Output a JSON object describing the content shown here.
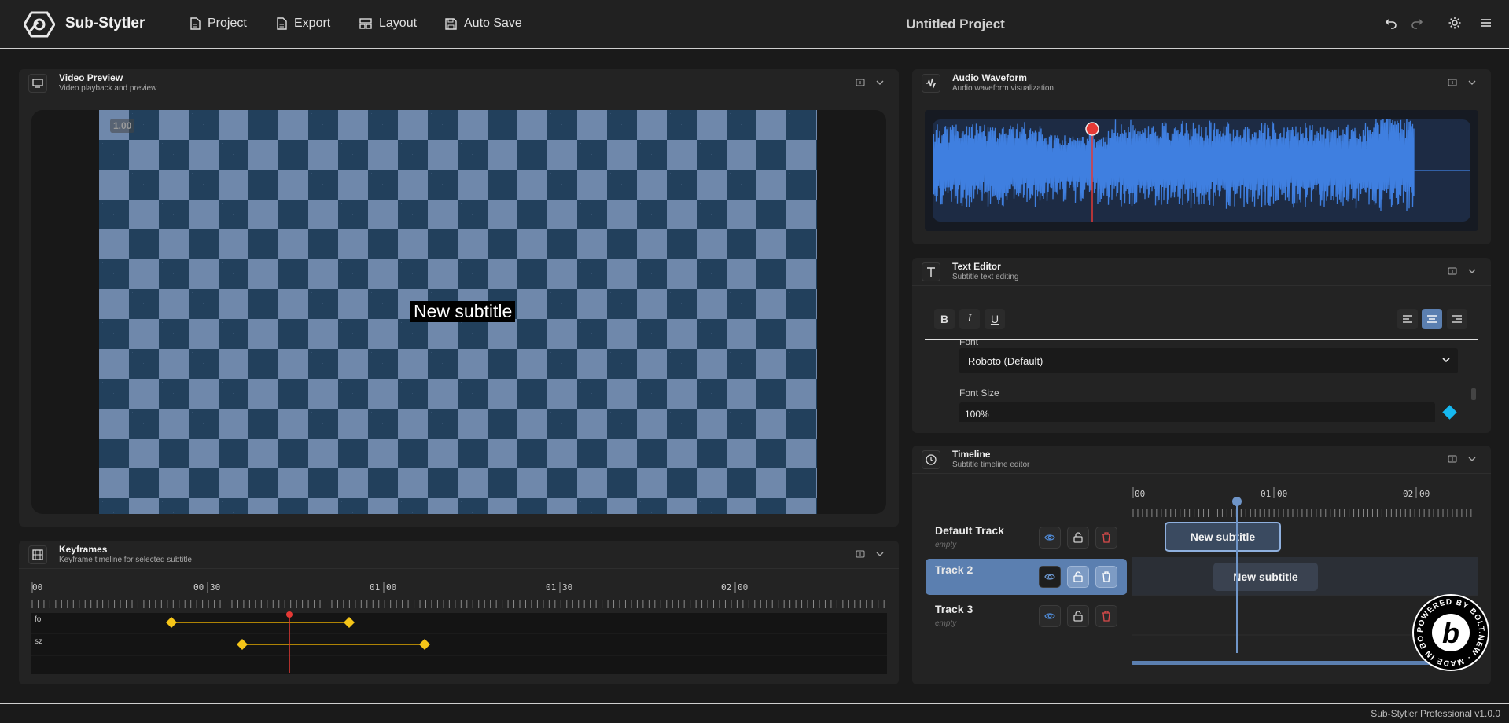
{
  "header": {
    "app_name": "Sub-Stytler",
    "menu": [
      {
        "label": "Project",
        "icon": "file-icon"
      },
      {
        "label": "Export",
        "icon": "file-export-icon"
      },
      {
        "label": "Layout",
        "icon": "layout-icon"
      },
      {
        "label": "Auto Save",
        "icon": "save-icon"
      }
    ],
    "project_title": "Untitled Project",
    "icons": [
      "undo-icon",
      "redo-icon",
      "sun-icon",
      "hamburger-menu-icon"
    ]
  },
  "video_preview": {
    "title": "Video Preview",
    "subtitle": "Video playback and preview",
    "zoom": "1.00",
    "overlay_text": "New subtitle"
  },
  "keyframes": {
    "title": "Keyframes",
    "subtitle": "Keyframe timeline for selected subtitle",
    "ruler": [
      "00",
      "00",
      "30",
      "01",
      "00",
      "01",
      "30",
      "02",
      "00"
    ],
    "tracks": [
      "fo",
      "sz"
    ]
  },
  "audio_waveform": {
    "title": "Audio Waveform",
    "subtitle": "Audio waveform visualization"
  },
  "text_editor": {
    "title": "Text Editor",
    "subtitle": "Subtitle text editing",
    "format_buttons": [
      "B",
      "I",
      "U"
    ],
    "align_buttons": [
      "align-left-icon",
      "align-center-icon",
      "align-right-icon"
    ],
    "active_align": "center",
    "font_label": "Font",
    "font_value": "Roboto (Default)",
    "font_size_label": "Font Size",
    "font_size_value": "100%"
  },
  "timeline": {
    "title": "Timeline",
    "subtitle": "Subtitle timeline editor",
    "ruler": [
      "00",
      "01",
      "00",
      "02",
      "00"
    ],
    "tracks": [
      {
        "name": "Default Track",
        "status": "empty",
        "clip": "New subtitle"
      },
      {
        "name": "Track 2",
        "status": "",
        "clip": "New subtitle"
      },
      {
        "name": "Track 3",
        "status": "empty",
        "clip": ""
      }
    ]
  },
  "badge": {
    "text": "POWERED BY BOLT.NEW · MADE IN BOLT.NEW ·",
    "letter": "b"
  },
  "footer": {
    "version": "Sub-Stytler Professional v1.0.0"
  },
  "colors": {
    "accent": "#5b7fb0",
    "keyframe": "#f5c518",
    "playhead": "#e53935",
    "waveform": "#3f7fe0"
  }
}
